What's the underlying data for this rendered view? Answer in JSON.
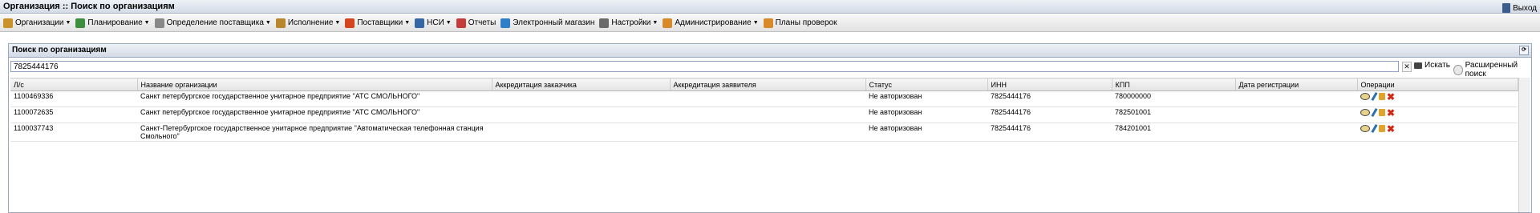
{
  "title": "Организация :: Поиск по организациям",
  "menu": [
    {
      "label": "Организации",
      "arrow": true,
      "icon": "organization-icon",
      "color": "#c9922a"
    },
    {
      "label": "Планирование",
      "arrow": true,
      "icon": "planning-icon",
      "color": "#3e8e3e"
    },
    {
      "label": "Определение поставщика",
      "arrow": true,
      "icon": "supplier-selection-icon",
      "color": "#888888"
    },
    {
      "label": "Исполнение",
      "arrow": true,
      "icon": "execution-icon",
      "color": "#b8862c"
    },
    {
      "label": "Поставщики",
      "arrow": true,
      "icon": "suppliers-icon",
      "color": "#d4451f"
    },
    {
      "label": "НСИ",
      "arrow": true,
      "icon": "reference-data-icon",
      "color": "#3566a6"
    },
    {
      "label": "Отчеты",
      "arrow": false,
      "icon": "reports-icon",
      "color": "#c43b3b"
    },
    {
      "label": "Электронный магазин",
      "arrow": false,
      "icon": "e-shop-icon",
      "color": "#2f7ec8"
    },
    {
      "label": "Настройки",
      "arrow": true,
      "icon": "settings-icon",
      "color": "#6a6a6a"
    },
    {
      "label": "Администрирование",
      "arrow": true,
      "icon": "admin-icon",
      "color": "#d88a2a"
    },
    {
      "label": "Планы проверок",
      "arrow": false,
      "icon": "inspection-plans-icon",
      "color": "#d88a2a"
    }
  ],
  "exit_label": "Выход",
  "panel": {
    "title": "Поиск по организациям",
    "search_value": "7825444176",
    "search_button": "Искать",
    "advanced_button": "Расширенный поиск"
  },
  "table": {
    "columns": [
      "Л/с",
      "Название организации",
      "Аккредитация заказчика",
      "Аккредитация заявителя",
      "Статус",
      "ИНН",
      "КПП",
      "Дата регистрации",
      "Операции"
    ],
    "rows": [
      [
        "1100469336",
        "Санкт петербургское государственное унитарное предприятие \"АТС СМОЛЬНОГО\"",
        "",
        "",
        "Не авторизован",
        "7825444176",
        "780000000",
        ""
      ],
      [
        "1100072635",
        "Санкт петербургское государственное унитарное предприятие \"АТС СМОЛЬНОГО\"",
        "",
        "",
        "Не авторизован",
        "7825444176",
        "782501001",
        ""
      ],
      [
        "1100037743",
        "Санкт-Петербургское государственное унитарное предприятие \"Автоматическая телефонная станция Смольного\"",
        "",
        "",
        "Не авторизован",
        "7825444176",
        "784201001",
        ""
      ]
    ]
  }
}
